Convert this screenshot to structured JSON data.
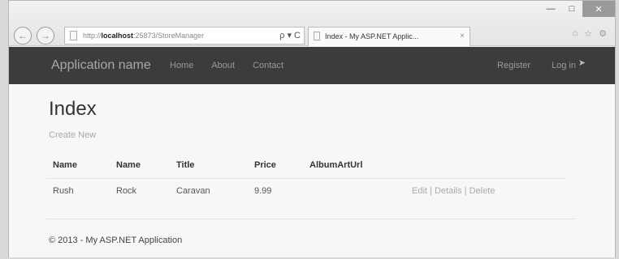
{
  "browser": {
    "address_prefix": "http://",
    "address_host": "localhost",
    "address_rest": ":25873/StoreManager",
    "address_tools": "ρ ▾ C",
    "tab_title": "Index - My ASP.NET Applic...",
    "tab_close": "×"
  },
  "navbar": {
    "brand": "Application name",
    "links": [
      "Home",
      "About",
      "Contact"
    ],
    "right_links": [
      "Register",
      "Log in"
    ]
  },
  "page": {
    "title": "Index",
    "create_link": "Create New"
  },
  "table": {
    "headers": [
      "Name",
      "Name",
      "Title",
      "Price",
      "AlbumArtUrl"
    ],
    "rows": [
      {
        "cells": [
          "Rush",
          "Rock",
          "Caravan",
          "9.99",
          ""
        ],
        "actions": [
          "Edit",
          "Details",
          "Delete"
        ]
      }
    ],
    "separator": "|"
  },
  "footer": {
    "text": "© 2013 - My ASP.NET Application"
  }
}
